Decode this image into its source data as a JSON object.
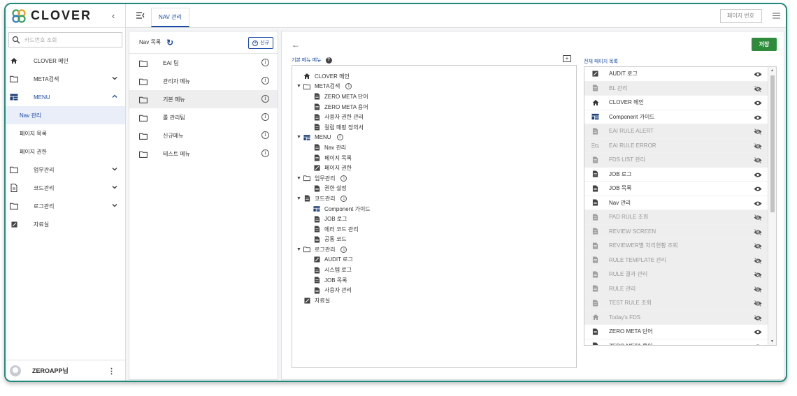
{
  "brand": {
    "name": "CLOVER",
    "accent": "#1f8a7a",
    "primary": "#1a4aa8",
    "save_color": "#2e8b3c"
  },
  "sidebar": {
    "search_placeholder": "카드번호 조회",
    "items": [
      {
        "label": "CLOVER 메인",
        "icon": "home-icon"
      },
      {
        "label": "META검색",
        "icon": "folder-icon",
        "expand": "down"
      },
      {
        "label": "MENU",
        "icon": "grid-icon",
        "expand": "up"
      },
      {
        "label": "업무관리",
        "icon": "folder-icon",
        "expand": "down"
      },
      {
        "label": "코드관리",
        "icon": "document-icon",
        "expand": "down"
      },
      {
        "label": "로그관리",
        "icon": "folder-icon",
        "expand": "down"
      },
      {
        "label": "자료실",
        "icon": "edit-icon"
      }
    ],
    "menu_children": [
      "Nav 관리",
      "페이지 목록",
      "페이지 권한"
    ],
    "user": "ZEROAPP님"
  },
  "topbar": {
    "tab_label": "NAV 관리",
    "page_no_placeholder": "페이지 번호"
  },
  "nav_list": {
    "title": "Nav 목록",
    "new_label": "신규",
    "items": [
      "EAI 팀",
      "관리자 메뉴",
      "기본 메뉴",
      "롤 관리팀",
      "신규메뉴",
      "테스트 메뉴"
    ]
  },
  "main": {
    "save_label": "저장",
    "tree_label": "기본 메뉴 메뉴",
    "all_pages_label": "전체 페이지 목록",
    "tree": [
      {
        "level": 0,
        "label": "CLOVER 메인",
        "icon": "home-icon"
      },
      {
        "level": 0,
        "label": "META검색",
        "icon": "folder-icon",
        "toggle": true,
        "info": true
      },
      {
        "level": 1,
        "label": "ZERO META 단어",
        "icon": "document-icon"
      },
      {
        "level": 1,
        "label": "ZERO META 용어",
        "icon": "document-icon"
      },
      {
        "level": 1,
        "label": "사용자 권한 관리",
        "icon": "document-icon"
      },
      {
        "level": 1,
        "label": "컬럼 매핑 정의서",
        "icon": "document-icon"
      },
      {
        "level": 0,
        "label": "MENU",
        "icon": "grid-icon",
        "toggle": true,
        "info": true
      },
      {
        "level": 1,
        "label": "Nav 관리",
        "icon": "document-icon"
      },
      {
        "level": 1,
        "label": "페이지 목록",
        "icon": "document-icon"
      },
      {
        "level": 1,
        "label": "페이지 권한",
        "icon": "edit-icon"
      },
      {
        "level": 0,
        "label": "업무관리",
        "icon": "folder-icon",
        "toggle": true,
        "info": true
      },
      {
        "level": 1,
        "label": "권한 설정",
        "icon": "document-icon"
      },
      {
        "level": 0,
        "label": "코드관리",
        "icon": "document-icon",
        "toggle": true,
        "info": true
      },
      {
        "level": 1,
        "label": "Component 가이드",
        "icon": "grid-icon"
      },
      {
        "level": 1,
        "label": "JOB 로그",
        "icon": "document-icon"
      },
      {
        "level": 1,
        "label": "에러 코드 관리",
        "icon": "document-icon"
      },
      {
        "level": 1,
        "label": "공통 코드",
        "icon": "document-icon"
      },
      {
        "level": 0,
        "label": "로그관리",
        "icon": "folder-icon",
        "toggle": true,
        "info": true
      },
      {
        "level": 1,
        "label": "AUDIT 로그",
        "icon": "edit-icon"
      },
      {
        "level": 1,
        "label": "시스템 로그",
        "icon": "document-icon"
      },
      {
        "level": 1,
        "label": "JOB 목록",
        "icon": "document-icon"
      },
      {
        "level": 1,
        "label": "사용자 관리",
        "icon": "document-icon"
      },
      {
        "level": 0,
        "label": "자료실",
        "icon": "edit-icon"
      }
    ],
    "pages": [
      {
        "label": "AUDIT 로그",
        "icon": "edit-icon",
        "disabled": false
      },
      {
        "label": "BL 관리",
        "icon": "document-icon",
        "disabled": true
      },
      {
        "label": "CLOVER 메인",
        "icon": "home-icon",
        "disabled": false
      },
      {
        "label": "Component 가이드",
        "icon": "grid-icon",
        "disabled": false
      },
      {
        "label": "EAI RULE ALERT",
        "icon": "document-icon",
        "disabled": true
      },
      {
        "label": "EAI RULE ERROR",
        "icon": "search-list-icon",
        "disabled": true
      },
      {
        "label": "FDS LIST 관리",
        "icon": "document-icon",
        "disabled": true
      },
      {
        "label": "JOB 로그",
        "icon": "document-icon",
        "disabled": false
      },
      {
        "label": "JOB 목록",
        "icon": "document-icon",
        "disabled": false
      },
      {
        "label": "Nav 관리",
        "icon": "document-icon",
        "disabled": false
      },
      {
        "label": "PAD RULE 조회",
        "icon": "document-icon",
        "disabled": true
      },
      {
        "label": "REVIEW SCREEN",
        "icon": "document-icon",
        "disabled": true
      },
      {
        "label": "REVIEWER별 처리현황 조회",
        "icon": "document-icon",
        "disabled": true
      },
      {
        "label": "RULE TEMPLATE 관리",
        "icon": "document-icon",
        "disabled": true
      },
      {
        "label": "RULE 결과 관리",
        "icon": "document-icon",
        "disabled": true
      },
      {
        "label": "RULE 관리",
        "icon": "document-icon",
        "disabled": true
      },
      {
        "label": "TEST RULE 조회",
        "icon": "document-icon",
        "disabled": true
      },
      {
        "label": "Today's FDS",
        "icon": "home-icon",
        "disabled": true
      },
      {
        "label": "ZERO META 단어",
        "icon": "document-icon",
        "disabled": false
      },
      {
        "label": "ZERO META 용어",
        "icon": "document-icon",
        "disabled": false
      }
    ]
  }
}
